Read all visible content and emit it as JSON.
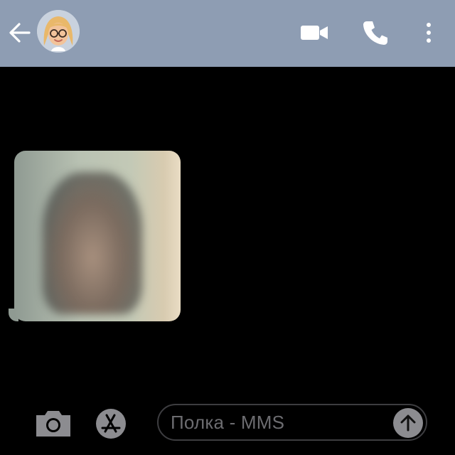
{
  "header": {
    "back_icon": "arrow-left-icon",
    "avatar_icon": "memoji-avatar",
    "video_icon": "video-camera-icon",
    "call_icon": "phone-icon",
    "more_icon": "more-vertical-icon",
    "background_color": "#8e9db3"
  },
  "thread": {
    "messages": [
      {
        "type": "image",
        "direction": "incoming",
        "content": "blurred-photo"
      }
    ]
  },
  "composer": {
    "camera_icon": "camera-icon",
    "apps_icon": "app-store-icon",
    "placeholder": "Полка - MMS",
    "send_icon": "arrow-up-icon"
  }
}
